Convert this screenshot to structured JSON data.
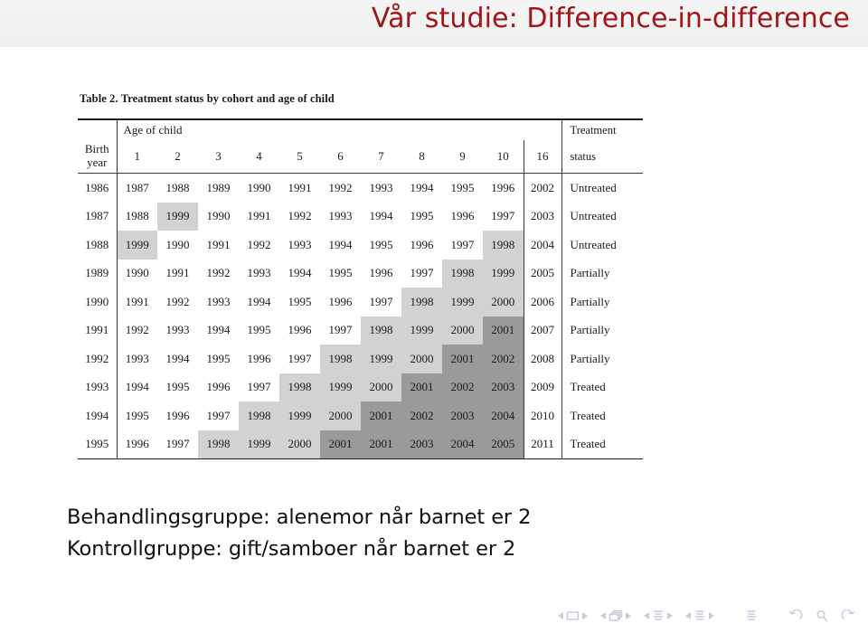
{
  "slide": {
    "title": "Vår studie: Difference-in-difference",
    "title_color": "#a11417"
  },
  "figure": {
    "caption_label": "Table 2.",
    "caption_text": "Treatment status by cohort and age of child",
    "header": {
      "birth_line1": "Birth",
      "birth_line2": "year",
      "age_group_label": "Age of child",
      "status_line1": "Treatment",
      "status_line2": "status",
      "age_columns": [
        "1",
        "2",
        "3",
        "4",
        "5",
        "6",
        "7",
        "8",
        "9",
        "10"
      ],
      "extra_column": "16"
    },
    "shading": {
      "light": "#d2d2d2",
      "dark": "#9a9a9a",
      "light_values": [
        "1998",
        "1999",
        "2000"
      ],
      "dark_values": [
        "2001",
        "2002",
        "2003",
        "2004",
        "2005"
      ]
    },
    "rows": [
      {
        "birth_year": "1986",
        "ages": [
          "1987",
          "1988",
          "1989",
          "1990",
          "1991",
          "1992",
          "1993",
          "1994",
          "1995",
          "1996"
        ],
        "age16": "2002",
        "status": "Untreated"
      },
      {
        "birth_year": "1987",
        "ages": [
          "1988",
          "1999",
          "1990",
          "1991",
          "1992",
          "1993",
          "1994",
          "1995",
          "1996",
          "1997"
        ],
        "age16": "2003",
        "status": "Untreated"
      },
      {
        "birth_year": "1988",
        "ages": [
          "1999",
          "1990",
          "1991",
          "1992",
          "1993",
          "1994",
          "1995",
          "1996",
          "1997",
          "1998"
        ],
        "age16": "2004",
        "status": "Untreated"
      },
      {
        "birth_year": "1989",
        "ages": [
          "1990",
          "1991",
          "1992",
          "1993",
          "1994",
          "1995",
          "1996",
          "1997",
          "1998",
          "1999"
        ],
        "age16": "2005",
        "status": "Partially"
      },
      {
        "birth_year": "1990",
        "ages": [
          "1991",
          "1992",
          "1993",
          "1994",
          "1995",
          "1996",
          "1997",
          "1998",
          "1999",
          "2000"
        ],
        "age16": "2006",
        "status": "Partially"
      },
      {
        "birth_year": "1991",
        "ages": [
          "1992",
          "1993",
          "1994",
          "1995",
          "1996",
          "1997",
          "1998",
          "1999",
          "2000",
          "2001"
        ],
        "age16": "2007",
        "status": "Partially"
      },
      {
        "birth_year": "1992",
        "ages": [
          "1993",
          "1994",
          "1995",
          "1996",
          "1997",
          "1998",
          "1999",
          "2000",
          "2001",
          "2002"
        ],
        "age16": "2008",
        "status": "Partially"
      },
      {
        "birth_year": "1993",
        "ages": [
          "1994",
          "1995",
          "1996",
          "1997",
          "1998",
          "1999",
          "2000",
          "2001",
          "2002",
          "2003"
        ],
        "age16": "2009",
        "status": "Treated"
      },
      {
        "birth_year": "1994",
        "ages": [
          "1995",
          "1996",
          "1997",
          "1998",
          "1999",
          "2000",
          "2001",
          "2002",
          "2003",
          "2004"
        ],
        "age16": "2010",
        "status": "Treated"
      },
      {
        "birth_year": "1995",
        "ages": [
          "1996",
          "1997",
          "1998",
          "1999",
          "2000",
          "2001",
          "2001",
          "2003",
          "2004",
          "2005"
        ],
        "age16": "2011",
        "status": "Treated"
      }
    ]
  },
  "bullets": [
    "Behandlingsgruppe: alenemor når barnet er 2",
    "Kontrollgruppe: gift/samboer når barnet er 2"
  ],
  "navbar": {
    "groups": [
      {
        "name": "slide-navigation",
        "icon": "slide-icon",
        "prev": "◀",
        "next": "▶"
      },
      {
        "name": "frame-navigation",
        "icon": "frames-icon",
        "prev": "◀",
        "next": "▶"
      },
      {
        "name": "subsection-navigation",
        "icon": "subsection-icon",
        "prev": "◀",
        "next": "▶"
      },
      {
        "name": "section-navigation",
        "icon": "section-icon",
        "prev": "◀",
        "next": "▶"
      }
    ],
    "presentation_icon": "presentation-icon",
    "back_icon": "back-arrow-icon",
    "find_icon": "find-magnifier-icon",
    "forward_icon": "forward-arrow-icon",
    "color": "#c9c9dd"
  }
}
